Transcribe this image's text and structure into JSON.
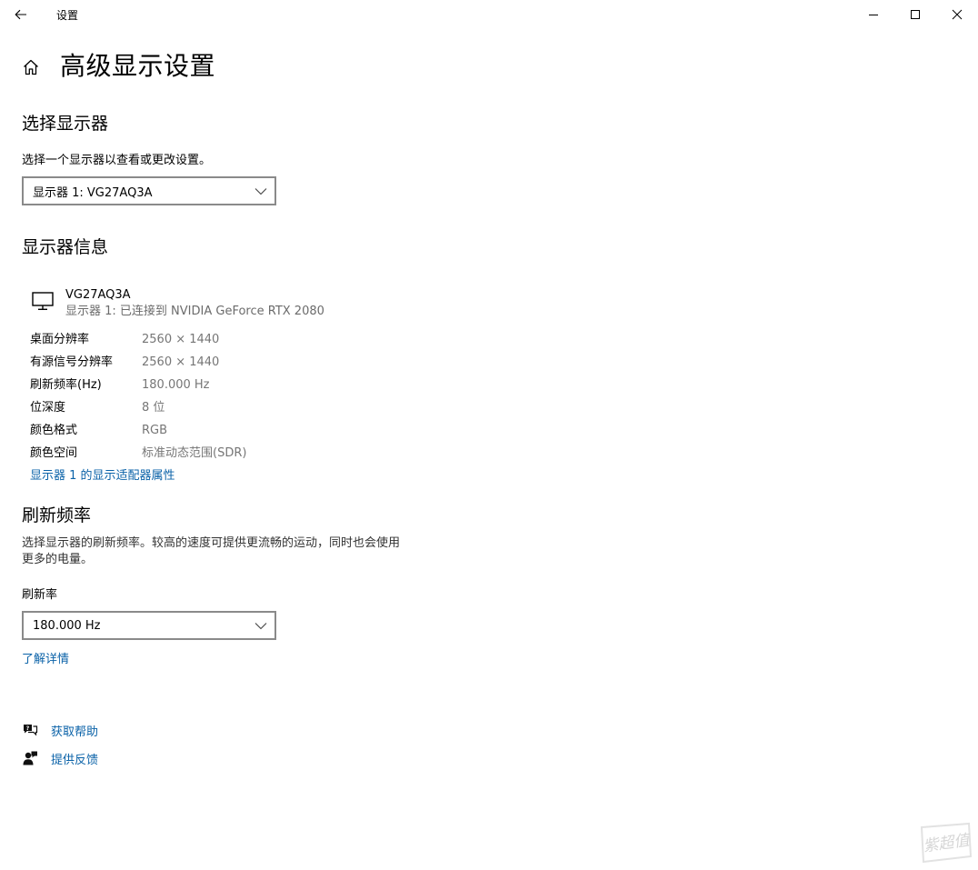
{
  "window": {
    "title": "设置",
    "icons": {
      "back": "back-arrow-icon",
      "minimize": "minimize-icon",
      "maximize": "maximize-icon",
      "close": "close-icon"
    }
  },
  "header": {
    "title": "高级显示设置",
    "home_icon": "home-icon"
  },
  "select_display": {
    "heading": "选择显示器",
    "instruction": "选择一个显示器以查看或更改设置。",
    "selected": "显示器 1: VG27AQ3A"
  },
  "display_info": {
    "heading": "显示器信息",
    "monitor_name": "VG27AQ3A",
    "monitor_connection": "显示器 1: 已连接到 NVIDIA GeForce RTX 2080",
    "rows": [
      {
        "key": "桌面分辨率",
        "value": "2560 × 1440"
      },
      {
        "key": "有源信号分辨率",
        "value": "2560 × 1440"
      },
      {
        "key": "刷新频率(Hz)",
        "value": "180.000 Hz"
      },
      {
        "key": "位深度",
        "value": "8 位"
      },
      {
        "key": "颜色格式",
        "value": "RGB"
      },
      {
        "key": "颜色空间",
        "value": "标准动态范围(SDR)"
      }
    ],
    "adapter_link": "显示器 1 的显示适配器属性"
  },
  "refresh_rate": {
    "heading": "刷新频率",
    "description_line1": "选择显示器的刷新频率。较高的速度可提供更流畅的运动，同时也会使用",
    "description_line2": "更多的电量。",
    "label": "刷新率",
    "selected": "180.000 Hz",
    "learn_more": "了解详情"
  },
  "help": {
    "get_help": "获取帮助",
    "feedback": "提供反馈"
  },
  "watermark": "紫超值",
  "colors": {
    "link": "#0a62a8",
    "muted": "#767676",
    "border": "#8a8a8a"
  }
}
